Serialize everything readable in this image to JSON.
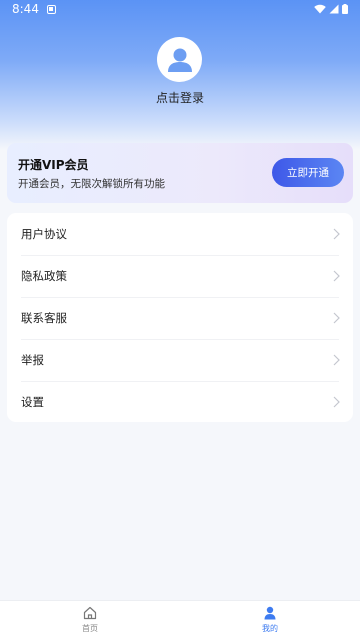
{
  "status_bar": {
    "time": "8:44"
  },
  "profile": {
    "login_label": "点击登录"
  },
  "vip": {
    "title": "开通VIP会员",
    "subtitle": "开通会员，无限次解锁所有功能",
    "button_label": "立即开通"
  },
  "menu": {
    "items": [
      {
        "label": "用户协议"
      },
      {
        "label": "隐私政策"
      },
      {
        "label": "联系客服"
      },
      {
        "label": "举报"
      },
      {
        "label": "设置"
      }
    ]
  },
  "tabbar": {
    "items": [
      {
        "label": "首页",
        "icon": "home-icon",
        "active": false
      },
      {
        "label": "我的",
        "icon": "person-icon",
        "active": true
      }
    ]
  },
  "colors": {
    "accent": "#3d7bf0",
    "vip_button_start": "#3e58e8",
    "vip_button_end": "#5b86f3"
  }
}
